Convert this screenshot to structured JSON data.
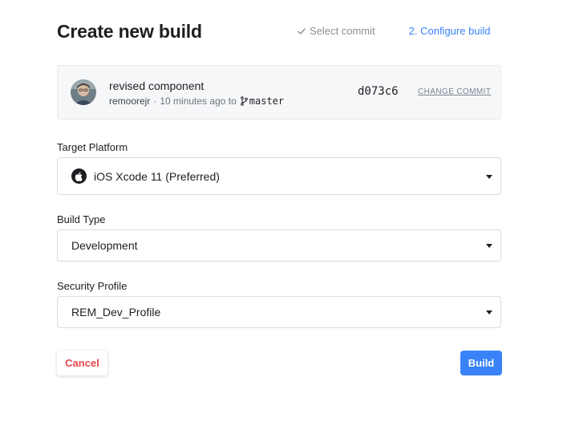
{
  "page": {
    "title": "Create new build"
  },
  "steps": {
    "step1": "Select commit",
    "step2": "2. Configure build"
  },
  "commit": {
    "message": "revised component",
    "author": "remoorejr",
    "time": "10 minutes ago to",
    "branch": "master",
    "sha": "d073c6",
    "change_label": "CHANGE COMMIT"
  },
  "fields": {
    "platform": {
      "label": "Target Platform",
      "value": "iOS Xcode 11 (Preferred)",
      "icon": "apple-icon"
    },
    "build_type": {
      "label": "Build Type",
      "value": "Development"
    },
    "security": {
      "label": "Security Profile",
      "value": "REM_Dev_Profile"
    }
  },
  "actions": {
    "cancel": "Cancel",
    "build": "Build"
  },
  "colors": {
    "accent": "#3a82f7",
    "danger": "#e5484d",
    "card_bg": "#f6f7f9"
  }
}
